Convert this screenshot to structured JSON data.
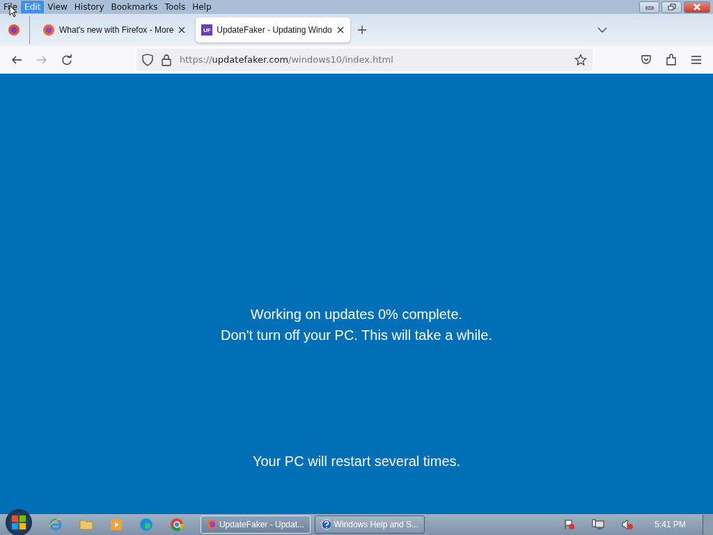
{
  "menu": [
    {
      "label": "File",
      "selected": false
    },
    {
      "label": "Edit",
      "selected": true
    },
    {
      "label": "View",
      "selected": false
    },
    {
      "label": "History",
      "selected": false
    },
    {
      "label": "Bookmarks",
      "selected": false
    },
    {
      "label": "Tools",
      "selected": false
    },
    {
      "label": "Help",
      "selected": false
    }
  ],
  "tabs": [
    {
      "kind": "firefox",
      "title": "What's new with Firefox - More",
      "selected": false
    },
    {
      "kind": "uf",
      "icon_text": "UF",
      "title": "UpdateFaker - Updating Windo",
      "selected": true
    }
  ],
  "address": {
    "scheme": "https://",
    "domain": "updatefaker.com",
    "path": "/windows10/index.html"
  },
  "page": {
    "lines": [
      "Working on updates  0% complete.",
      "Don't turn off your PC. This will take a while."
    ],
    "footer": "Your PC will restart several times."
  },
  "taskbar": {
    "windows": [
      {
        "kind": "firefox",
        "label": "UpdateFaker - Updat...",
        "selected": true
      },
      {
        "kind": "help",
        "label": "Windows Help and S...",
        "selected": false
      }
    ],
    "clock": "5:41 PM"
  }
}
